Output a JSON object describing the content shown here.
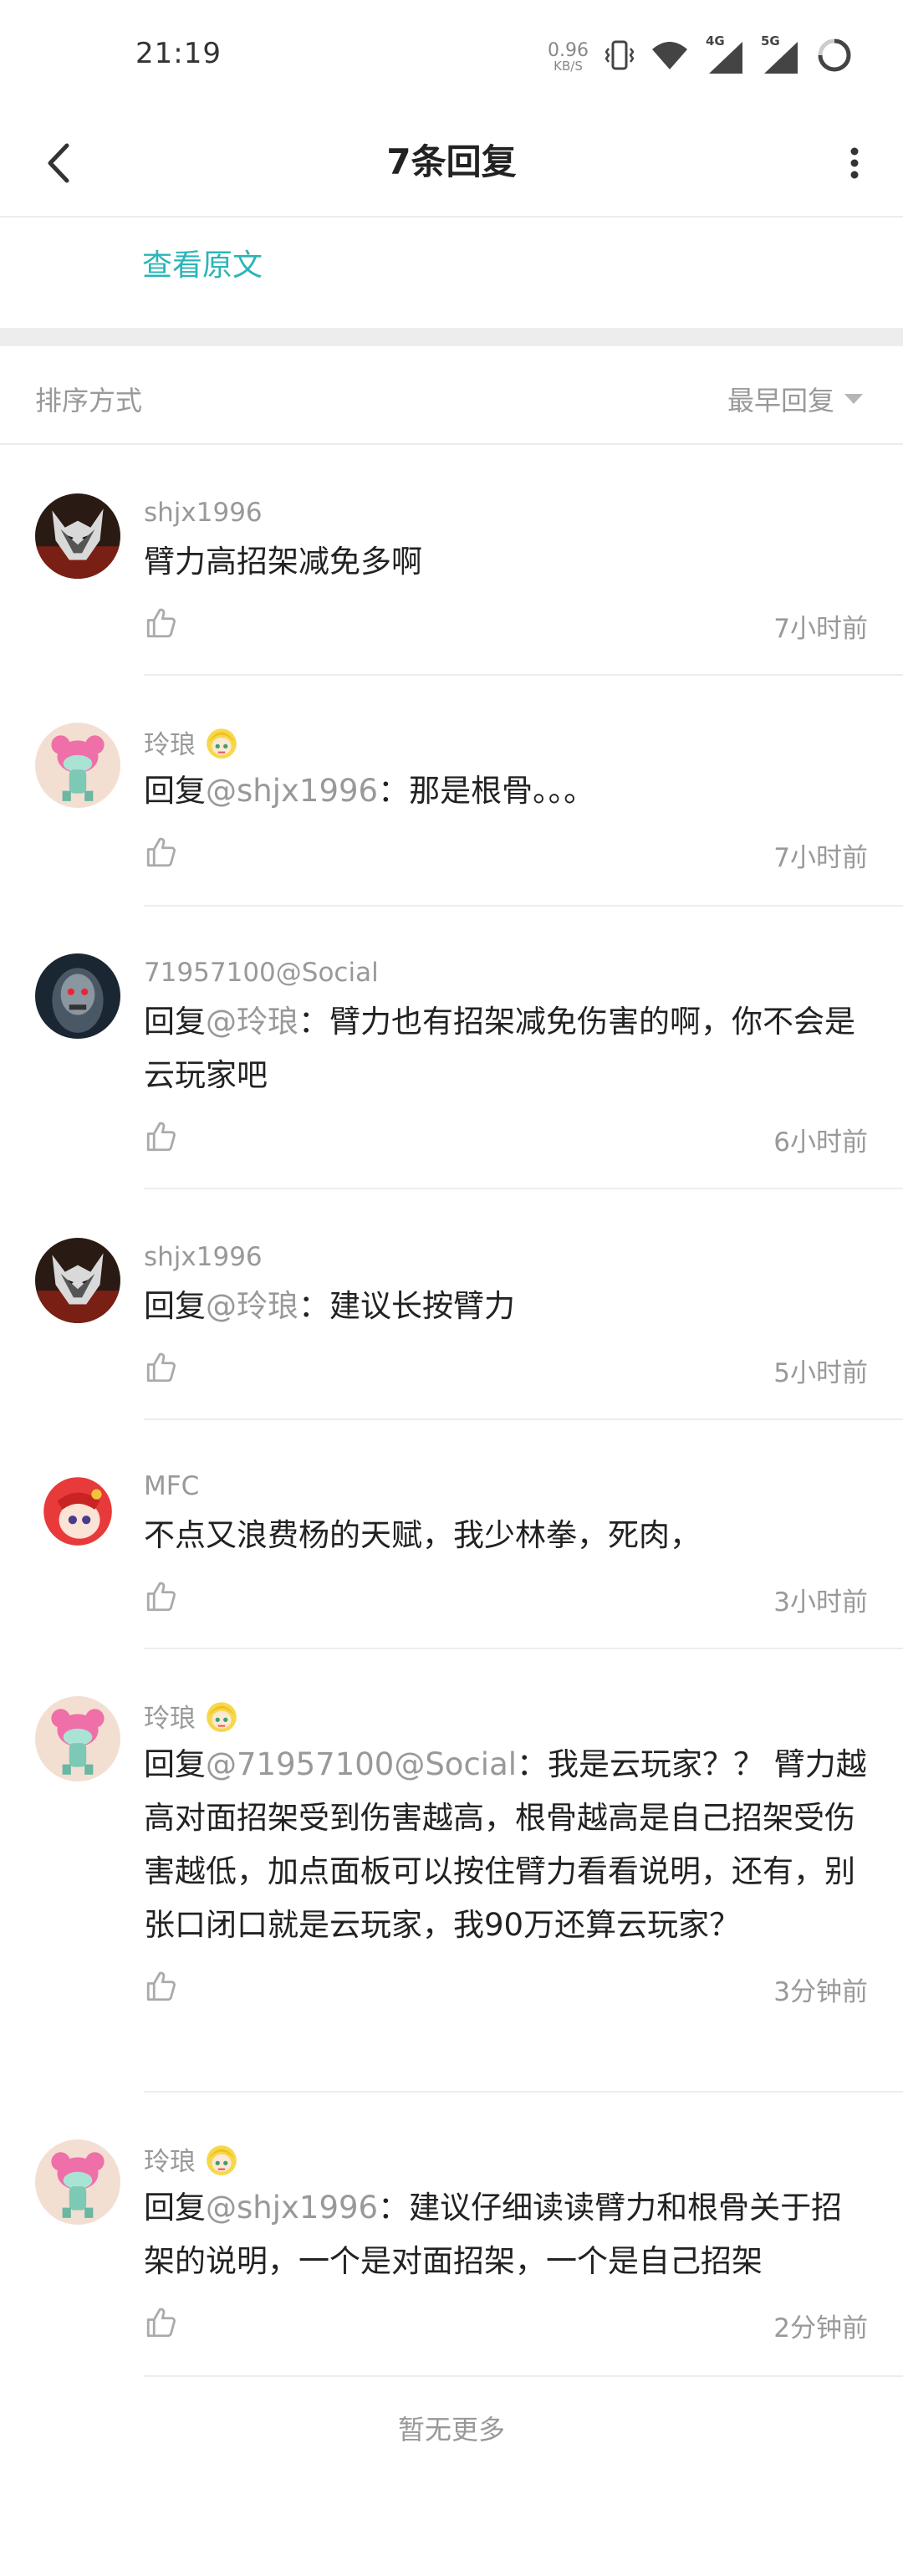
{
  "status": {
    "time": "21:19",
    "speed_value": "0.96",
    "speed_unit": "KB/S",
    "net_4g": "4G",
    "net_5g": "5G"
  },
  "header": {
    "title": "7条回复"
  },
  "view_original": "查看原文",
  "sort": {
    "label": "排序方式",
    "value": "最早回复"
  },
  "comments": [
    {
      "user": "shjx1996",
      "reply_prefix": "",
      "mention": "",
      "after_mention": "",
      "text": "臂力高招架减免多啊",
      "time": "7小时前"
    },
    {
      "user": "玲琅",
      "reply_prefix": "回复",
      "mention": "@shjx1996",
      "after_mention": "：",
      "text": "那是根骨。。。",
      "time": "7小时前"
    },
    {
      "user": "71957100@Social",
      "reply_prefix": "回复",
      "mention": "@玲琅",
      "after_mention": "：",
      "text": "臂力也有招架减免伤害的啊，你不会是云玩家吧",
      "time": "6小时前"
    },
    {
      "user": "shjx1996",
      "reply_prefix": "回复",
      "mention": "@玲琅",
      "after_mention": "：",
      "text": "建议长按臂力",
      "time": "5小时前"
    },
    {
      "user": "MFC",
      "reply_prefix": "",
      "mention": "",
      "after_mention": "",
      "text": "不点又浪费杨的天赋，我少林拳，死肉，",
      "time": "3小时前"
    },
    {
      "user": "玲琅",
      "reply_prefix": "回复",
      "mention": "@71957100@Social",
      "after_mention": "：",
      "text": "我是云玩家？？ 臂力越高对面招架受到伤害越高，根骨越高是自己招架受伤害越低，加点面板可以按住臂力看看说明，还有，别张口闭口就是云玩家，我90万还算云玩家？",
      "time": "3分钟前"
    },
    {
      "user": "玲琅",
      "reply_prefix": "回复",
      "mention": "@shjx1996",
      "after_mention": "：",
      "text": "建议仔细读读臂力和根骨关于招架的说明，一个是对面招架，一个是自己招架",
      "time": "2分钟前"
    }
  ],
  "footer": {
    "no_more": "暂无更多"
  },
  "colors": {
    "accent": "#2bb5b8",
    "meta": "#999999",
    "divider": "#ededed"
  }
}
